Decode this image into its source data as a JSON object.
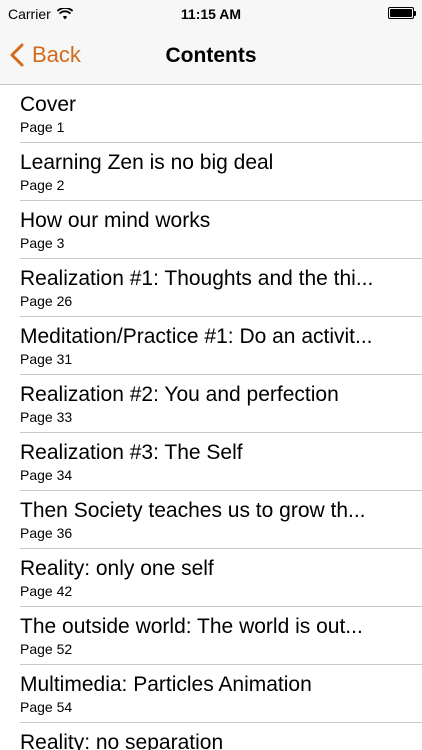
{
  "status_bar": {
    "carrier": "Carrier",
    "time": "11:15 AM"
  },
  "nav": {
    "back_label": "Back",
    "title": "Contents"
  },
  "colors": {
    "accent": "#d46b1c",
    "bar_background": "#f7f7f7",
    "separator": "#c8c7cc"
  },
  "items": [
    {
      "title": "Cover",
      "page": "Page 1"
    },
    {
      "title": "Learning Zen is no big deal",
      "page": "Page 2"
    },
    {
      "title": "How our mind works",
      "page": "Page 3"
    },
    {
      "title": "Realization #1: Thoughts and the thi...",
      "page": "Page 26"
    },
    {
      "title": "Meditation/Practice #1: Do an activit...",
      "page": "Page 31"
    },
    {
      "title": "Realization #2: You and perfection",
      "page": "Page 33"
    },
    {
      "title": "Realization #3: The Self",
      "page": "Page 34"
    },
    {
      "title": "Then Society teaches us to grow th...",
      "page": "Page 36"
    },
    {
      "title": "Reality: only one self",
      "page": "Page 42"
    },
    {
      "title": "The outside world: The world is out...",
      "page": "Page 52"
    },
    {
      "title": "Multimedia: Particles Animation",
      "page": "Page 54"
    },
    {
      "title": "Reality: no separation",
      "page": ""
    }
  ]
}
